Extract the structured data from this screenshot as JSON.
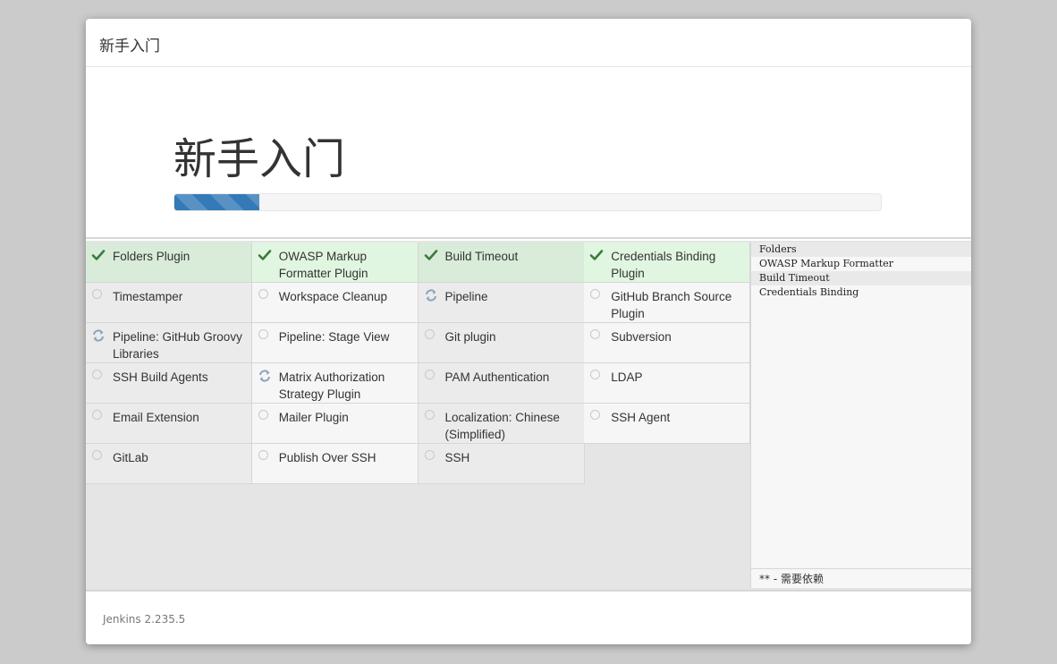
{
  "dialog": {
    "header_title": "新手入门",
    "hero_title": "新手入门",
    "progress": 0.12,
    "version": "Jenkins 2.235.5"
  },
  "plugins": [
    {
      "name": "Folders Plugin",
      "status": "installed"
    },
    {
      "name": "OWASP Markup Formatter Plugin",
      "status": "installed"
    },
    {
      "name": "Build Timeout",
      "status": "installed"
    },
    {
      "name": "Credentials Binding Plugin",
      "status": "installed"
    },
    {
      "name": "Timestamper",
      "status": "pending"
    },
    {
      "name": "Workspace Cleanup",
      "status": "pending"
    },
    {
      "name": "Pipeline",
      "status": "installing"
    },
    {
      "name": "GitHub Branch Source Plugin",
      "status": "pending"
    },
    {
      "name": "Pipeline: GitHub Groovy Libraries",
      "status": "installing"
    },
    {
      "name": "Pipeline: Stage View",
      "status": "pending"
    },
    {
      "name": "Git plugin",
      "status": "pending"
    },
    {
      "name": "Subversion",
      "status": "pending"
    },
    {
      "name": "SSH Build Agents",
      "status": "pending"
    },
    {
      "name": "Matrix Authorization Strategy Plugin",
      "status": "installing"
    },
    {
      "name": "PAM Authentication",
      "status": "pending"
    },
    {
      "name": "LDAP",
      "status": "pending"
    },
    {
      "name": "Email Extension",
      "status": "pending"
    },
    {
      "name": "Mailer Plugin",
      "status": "pending"
    },
    {
      "name": "Localization: Chinese (Simplified)",
      "status": "pending"
    },
    {
      "name": "SSH Agent",
      "status": "pending"
    },
    {
      "name": "GitLab",
      "status": "pending"
    },
    {
      "name": "Publish Over SSH",
      "status": "pending"
    },
    {
      "name": "SSH",
      "status": "pending"
    }
  ],
  "install_log": {
    "lines": [
      "Folders",
      "OWASP Markup Formatter",
      "Build Timeout",
      "Credentials Binding"
    ],
    "footer": "** - 需要依赖"
  },
  "colors": {
    "check": "#3c7a3e",
    "spinner": "#8aa4bd",
    "progress": "#337ab7"
  }
}
